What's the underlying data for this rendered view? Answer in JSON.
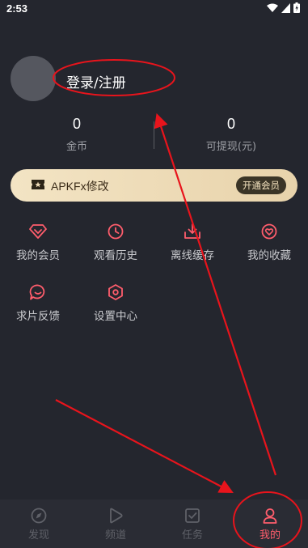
{
  "status": {
    "time": "2:53"
  },
  "profile": {
    "login_text": "登录/注册"
  },
  "stats": [
    {
      "value": "0",
      "label": "金币"
    },
    {
      "value": "0",
      "label": "可提现(元)"
    }
  ],
  "vip_banner": {
    "text": "APKFx修改",
    "button": "开通会员"
  },
  "menu": [
    {
      "label": "我的会员",
      "icon": "diamond-icon"
    },
    {
      "label": "观看历史",
      "icon": "clock-icon"
    },
    {
      "label": "离线缓存",
      "icon": "download-icon"
    },
    {
      "label": "我的收藏",
      "icon": "heart-icon"
    },
    {
      "label": "求片反馈",
      "icon": "chat-bubble-icon"
    },
    {
      "label": "设置中心",
      "icon": "settings-hexagon-icon"
    }
  ],
  "nav": [
    {
      "label": "发现",
      "icon": "compass-icon",
      "active": false
    },
    {
      "label": "频道",
      "icon": "play-icon",
      "active": false
    },
    {
      "label": "任务",
      "icon": "task-icon",
      "active": false
    },
    {
      "label": "我的",
      "icon": "user-icon",
      "active": true
    }
  ],
  "colors": {
    "background": "#24262e",
    "accent": "#ff5d6c",
    "annotation": "#e8141c",
    "vip_gold": "#efdcb8"
  }
}
